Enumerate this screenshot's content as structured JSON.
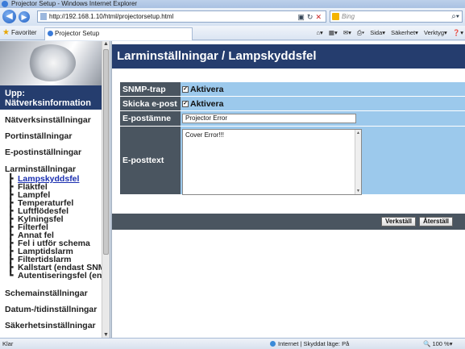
{
  "browser": {
    "title": "Projector Setup - Windows Internet Explorer",
    "url": "http://192.168.1.10/html/projectorsetup.html",
    "search_placeholder": "Bing",
    "favorites_label": "Favoriter",
    "tab_title": "Projector Setup",
    "tools": [
      "Sida",
      "Säkerhet",
      "Verktyg"
    ],
    "status_text": "Klar",
    "zone_text": "Internet | Skyddat läge: På",
    "zoom": "100 %"
  },
  "sidebar": {
    "up_label": "Upp: Nätverksinformation",
    "items": [
      "Nätverksinställningar",
      "Portinställningar",
      "E-postinställningar",
      "Larminställningar"
    ],
    "subitems": [
      "Lampskyddsfel",
      "Fläktfel",
      "Lampfel",
      "Temperaturfel",
      "Luftflödesfel",
      "Kylningsfel",
      "Filterfel",
      "Annat fel",
      "Fel i utför schema",
      "Lamptidslarm",
      "Filtertidslarm",
      "Kallstart (endast SNMP",
      "Autentiseringsfel (en"
    ],
    "items_after": [
      "Schemainställningar",
      "Datum-/tidinställningar",
      "Säkerhetsinställningar"
    ]
  },
  "main": {
    "page_title": "Larminställningar / Lampskyddsfel",
    "form": {
      "snmp_label": "SNMP-trap",
      "snmp_value": "Aktivera",
      "email_label": "Skicka e-post",
      "email_value": "Aktivera",
      "subject_label": "E-postämne",
      "subject_value": "Projector Error",
      "body_label": "E-posttext",
      "body_value": "Cover Error!!!"
    },
    "buttons": {
      "apply": "Verkställ",
      "reset": "Återställ"
    }
  }
}
